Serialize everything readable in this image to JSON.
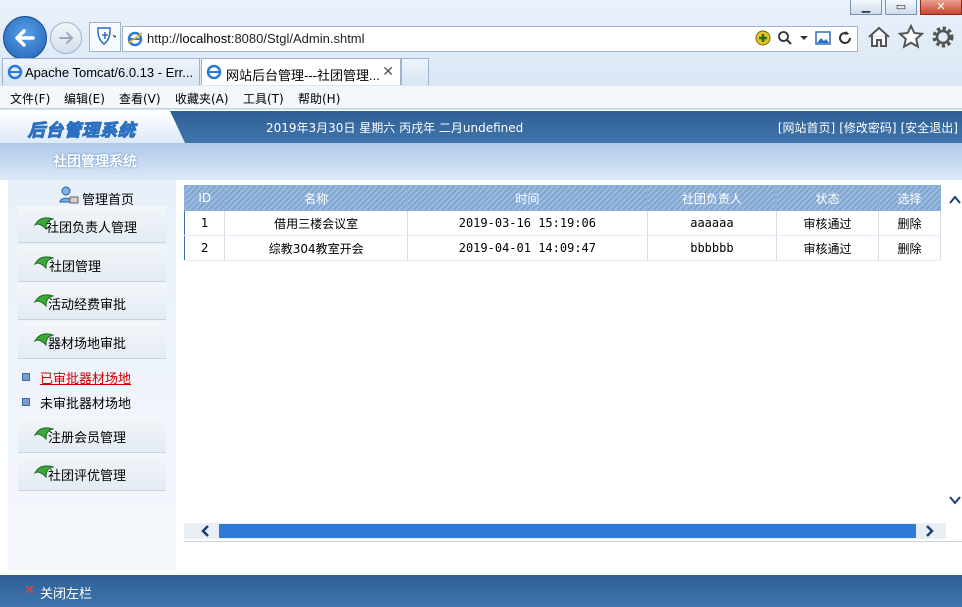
{
  "browser": {
    "url_prefix": "http://",
    "url_host": "localhost",
    "url_rest": ":8080/Stgl/Admin.shtml",
    "tabs": [
      {
        "label": "Apache Tomcat/6.0.13 - Err...",
        "active": false
      },
      {
        "label": "网站后台管理---社团管理...",
        "active": true
      }
    ],
    "menu": [
      "文件(F)",
      "编辑(E)",
      "查看(V)",
      "收藏夹(A)",
      "工具(T)",
      "帮助(H)"
    ]
  },
  "header": {
    "logo": "后台管理系统",
    "date": "2019年3月30日  星期六  丙戌年  二月undefined",
    "links": [
      "[网站首页]",
      "[修改密码]",
      "[安全退出]"
    ]
  },
  "band": {
    "title": "社团管理系统"
  },
  "sidebar": {
    "home": "管理首页",
    "items": [
      {
        "label": "社团负责人管理"
      },
      {
        "label": "社团管理"
      },
      {
        "label": "活动经费审批"
      },
      {
        "label": "器材场地审批"
      }
    ],
    "subitems": [
      {
        "label": "已审批器材场地",
        "active": true
      },
      {
        "label": "未审批器材场地",
        "active": false
      }
    ],
    "items2": [
      {
        "label": "注册会员管理"
      },
      {
        "label": "社团评优管理"
      }
    ]
  },
  "table": {
    "columns": [
      "ID",
      "名称",
      "时间",
      "社团负责人",
      "状态",
      "选择"
    ],
    "rows": [
      {
        "id": "1",
        "name": "借用三楼会议室",
        "time": "2019-03-16 15:19:06",
        "leader": "aaaaaa",
        "status": "审核通过",
        "action": "删除"
      },
      {
        "id": "2",
        "name": "综教304教室开会",
        "time": "2019-04-01 14:09:47",
        "leader": "bbbbbb",
        "status": "审核通过",
        "action": "删除"
      }
    ]
  },
  "footer": {
    "close_left": "关闭左栏"
  },
  "colors": {
    "header_blue": "#2e5f93",
    "scroll_thumb": "#2f7bd8",
    "active_link": "#d00000"
  }
}
